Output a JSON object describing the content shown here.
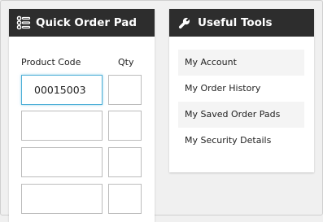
{
  "quick_order": {
    "title": "Quick Order Pad",
    "product_code_label": "Product Code",
    "qty_label": "Qty",
    "rows": [
      {
        "product_code": "00015003",
        "qty": ""
      },
      {
        "product_code": "",
        "qty": ""
      },
      {
        "product_code": "",
        "qty": ""
      },
      {
        "product_code": "",
        "qty": ""
      }
    ]
  },
  "useful_tools": {
    "title": "Useful Tools",
    "items": [
      {
        "label": "My Account"
      },
      {
        "label": "My Order History"
      },
      {
        "label": "My Saved Order Pads"
      },
      {
        "label": "My Security Details"
      }
    ]
  },
  "icons": {
    "quick_order": "list-icon",
    "useful_tools": "wrench-icon"
  },
  "colors": {
    "header_bg": "#2d2d2d",
    "focus_border": "#4fb0d8"
  }
}
